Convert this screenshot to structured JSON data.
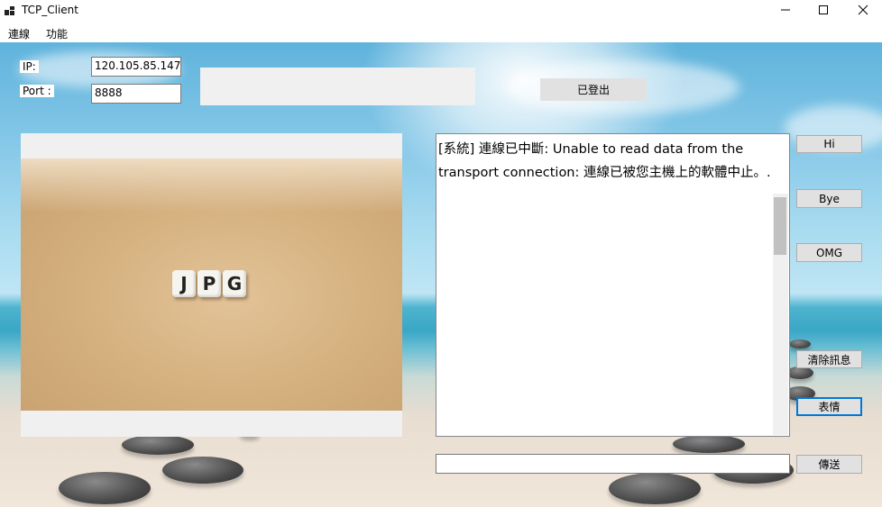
{
  "window": {
    "title": "TCP_Client"
  },
  "menu": {
    "items": [
      "連線",
      "功能"
    ]
  },
  "connection": {
    "ip_label": "IP:",
    "ip_value": "120.105.85.147",
    "port_label": "Port :",
    "port_value": "8888",
    "status_button_label": "已登出"
  },
  "image": {
    "dice_letters": [
      "J",
      "P",
      "G"
    ]
  },
  "log": {
    "lines": [
      "[系統] 連線已中斷: Unable to read data from the",
      "transport connection: 連線已被您主機上的軟體中止。."
    ]
  },
  "quick_buttons": {
    "hi": "Hi",
    "bye": "Bye",
    "omg": "OMG"
  },
  "actions": {
    "clear": "清除訊息",
    "emoji": "表情",
    "send": "傳送"
  },
  "input": {
    "value": ""
  },
  "colors": {
    "focus": "#0078d7",
    "button_bg": "#e1e1e1",
    "panel_bg": "#f0f0f0"
  }
}
